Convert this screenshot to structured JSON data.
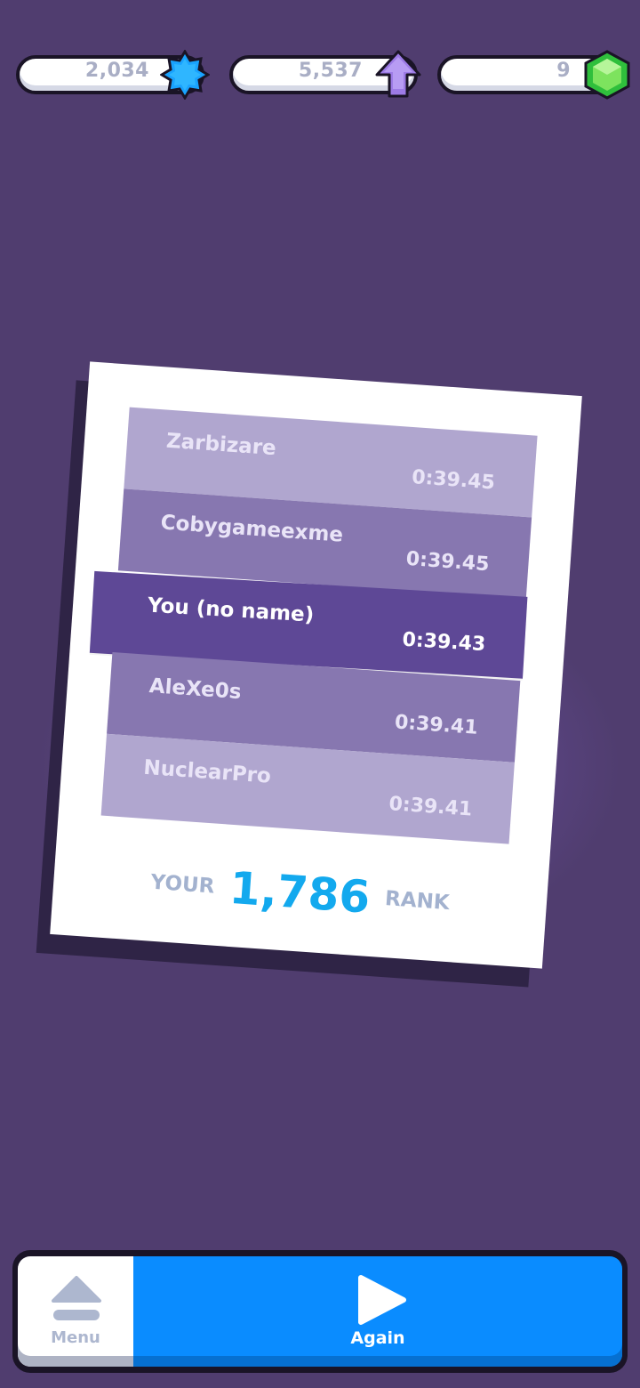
{
  "currencies": [
    {
      "value": "2,034",
      "icon": "blue-star-gem-icon",
      "color": "#19a3ff"
    },
    {
      "value": "5,537",
      "icon": "purple-up-arrow-icon",
      "color": "#9d7be6"
    },
    {
      "value": "9",
      "icon": "green-hexagon-gem-icon",
      "color": "#2fbf3c"
    }
  ],
  "leaderboard": {
    "rows": [
      {
        "name": "Zarbizare",
        "time": "0:39.45"
      },
      {
        "name": "Cobygameexme",
        "time": "0:39.45"
      },
      {
        "name": "You (no name)",
        "time": "0:39.43"
      },
      {
        "name": "AleXe0s",
        "time": "0:39.41"
      },
      {
        "name": "NuclearPro",
        "time": "0:39.41"
      }
    ],
    "rank_prefix": "YOUR",
    "rank_value": "1,786",
    "rank_suffix": "RANK"
  },
  "buttons": {
    "menu_label": "Menu",
    "again_label": "Again"
  },
  "colors": {
    "background": "#503d6f",
    "highlight_row": "#5e4896",
    "rank_accent": "#13a9ee",
    "again_button": "#0a8cff"
  }
}
